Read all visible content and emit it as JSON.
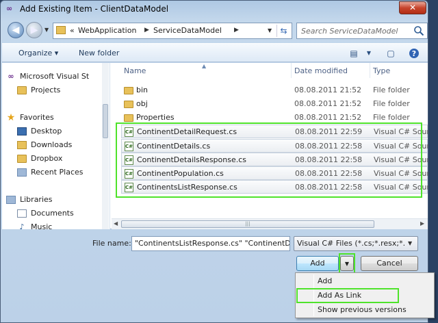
{
  "window": {
    "title": "Add Existing Item - ClientDataModel",
    "close_label": "✕"
  },
  "navbar": {
    "address": {
      "overflow": "«",
      "segments": [
        "WebApplication",
        "ServiceDataModel"
      ]
    },
    "search_placeholder": "Search ServiceDataModel"
  },
  "toolbar": {
    "organize": "Organize ▾",
    "new_folder": "New folder",
    "view_icon": "view-options-icon",
    "preview_icon": "preview-pane-icon",
    "help_icon": "help-icon"
  },
  "nav_pane": {
    "items": [
      {
        "label": "Microsoft Visual St",
        "icon": "vs-icon"
      },
      {
        "label": "Projects",
        "icon": "folder-icon"
      },
      {
        "label": "Favorites",
        "icon": "star-icon"
      },
      {
        "label": "Desktop",
        "icon": "desktop-icon"
      },
      {
        "label": "Downloads",
        "icon": "downloads-icon"
      },
      {
        "label": "Dropbox",
        "icon": "folder-icon"
      },
      {
        "label": "Recent Places",
        "icon": "recent-places-icon"
      },
      {
        "label": "Libraries",
        "icon": "libraries-icon"
      },
      {
        "label": "Documents",
        "icon": "documents-icon"
      },
      {
        "label": "Music",
        "icon": "music-icon"
      }
    ]
  },
  "file_list": {
    "columns": {
      "name": "Name",
      "date": "Date modified",
      "type": "Type"
    },
    "rows": [
      {
        "name": "bin",
        "date": "08.08.2011 21:52",
        "type": "File folder",
        "kind": "folder"
      },
      {
        "name": "obj",
        "date": "08.08.2011 21:52",
        "type": "File folder",
        "kind": "folder"
      },
      {
        "name": "Properties",
        "date": "08.08.2011 21:52",
        "type": "File folder",
        "kind": "folder"
      },
      {
        "name": "ContinentDetailRequest.cs",
        "date": "08.08.2011 22:59",
        "type": "Visual C# Source",
        "kind": "cs"
      },
      {
        "name": "ContinentDetails.cs",
        "date": "08.08.2011 22:58",
        "type": "Visual C# Source",
        "kind": "cs"
      },
      {
        "name": "ContinentDetailsResponse.cs",
        "date": "08.08.2011 22:58",
        "type": "Visual C# Source",
        "kind": "cs"
      },
      {
        "name": "ContinentPopulation.cs",
        "date": "08.08.2011 22:58",
        "type": "Visual C# Source",
        "kind": "cs"
      },
      {
        "name": "ContinentsListResponse.cs",
        "date": "08.08.2011 22:58",
        "type": "Visual C# Source",
        "kind": "cs"
      }
    ]
  },
  "footer": {
    "file_name_label": "File name:",
    "file_name_value": "\"ContinentsListResponse.cs\" \"ContinentDetailRequest.cs\"",
    "filter_value": "Visual C# Files (*.cs;*.resx;*.settings)",
    "add_label": "Add",
    "cancel_label": "Cancel"
  },
  "add_menu": {
    "items": [
      "Add",
      "Add As Link",
      "Show previous versions"
    ]
  },
  "colors": {
    "highlight": "#4ee32a"
  }
}
